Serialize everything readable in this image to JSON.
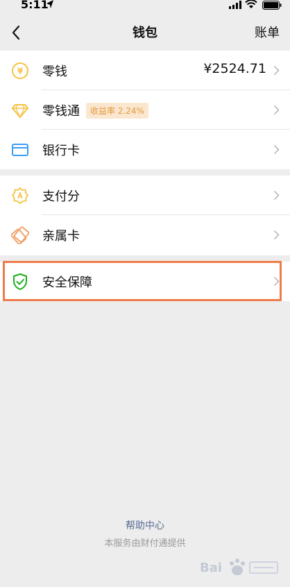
{
  "status_bar": {
    "time": "5:11"
  },
  "nav": {
    "title": "钱包",
    "right": "账单"
  },
  "wallet_items": [
    {
      "label": "零钱",
      "value": "¥2524.71",
      "icon": "yuan-coin-icon"
    },
    {
      "label": "零钱通",
      "badge": "收益率 2.24%",
      "icon": "diamond-icon"
    },
    {
      "label": "银行卡",
      "icon": "bank-card-icon"
    }
  ],
  "service_items": [
    {
      "label": "支付分",
      "icon": "payment-score-icon"
    },
    {
      "label": "亲属卡",
      "icon": "family-card-icon"
    }
  ],
  "security": {
    "label": "安全保障",
    "icon": "shield-icon"
  },
  "footer": {
    "help": "帮助中心",
    "provider": "本服务由财付通提供"
  },
  "colors": {
    "accent_yellow": "#f5c242",
    "card_blue": "#3b9df5",
    "orange": "#f0a36b",
    "shield_green": "#1aad19",
    "highlight": "#f07b4a",
    "link": "#576b95"
  },
  "watermark_text": "Baidu 经验"
}
